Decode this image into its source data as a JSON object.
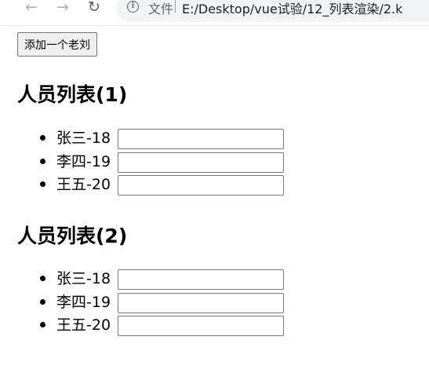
{
  "browser": {
    "security_label": "文件",
    "url": "E:/Desktop/vue试验/12_列表渲染/2.k"
  },
  "add_button_label": "添加一个老刘",
  "lists": [
    {
      "title": "人员列表(1)",
      "items": [
        {
          "label": "张三-18",
          "input_value": ""
        },
        {
          "label": "李四-19",
          "input_value": ""
        },
        {
          "label": "王五-20",
          "input_value": ""
        }
      ]
    },
    {
      "title": "人员列表(2)",
      "items": [
        {
          "label": "张三-18",
          "input_value": ""
        },
        {
          "label": "李四-19",
          "input_value": ""
        },
        {
          "label": "王五-20",
          "input_value": ""
        }
      ]
    }
  ]
}
